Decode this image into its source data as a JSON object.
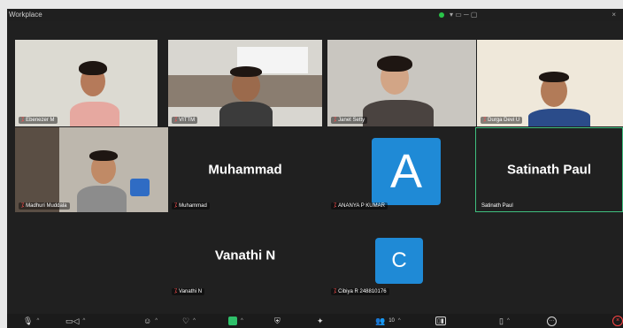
{
  "window": {
    "title": "Workplace"
  },
  "tiles": [
    {
      "id": "t1",
      "name": "Ebenezer M"
    },
    {
      "id": "t2",
      "name": "VITTM"
    },
    {
      "id": "t3",
      "name": "Janet Setty"
    },
    {
      "id": "t4",
      "name": "Durga Devi U"
    },
    {
      "id": "t5",
      "name": "Madhuri Muddala"
    },
    {
      "id": "t6",
      "name": "Muhammad",
      "display": "Muhammad"
    },
    {
      "id": "t7",
      "name": "ANANYA P KUMAR",
      "initial": "A"
    },
    {
      "id": "t8",
      "name": "Satinath Paul",
      "display": "Satinath Paul"
    },
    {
      "id": "t9",
      "name": "Vanathi N",
      "display": "Vanathi N"
    },
    {
      "id": "t10",
      "name": "Cibiya R 248810176",
      "initial": "C"
    }
  ],
  "toolbar": {
    "participants_count": "10"
  },
  "colors": {
    "avatar_blue": "#1f8ad6",
    "active_border": "#3fbf7f",
    "camera_on": "#2fc06a",
    "leave_red": "#ff4545"
  }
}
